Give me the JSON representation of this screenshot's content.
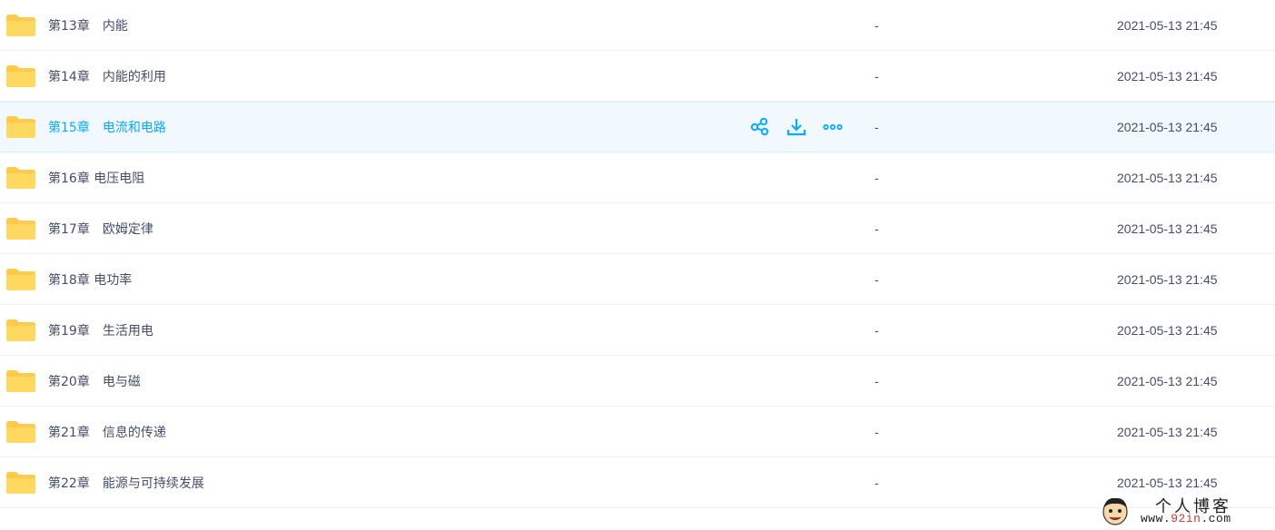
{
  "file_list": {
    "rows": [
      {
        "name": "第13章　内能",
        "size": "-",
        "mtime": "2021-05-13 21:45",
        "icon": "folder-icon"
      },
      {
        "name": "第14章　内能的利用",
        "size": "-",
        "mtime": "2021-05-13 21:45",
        "icon": "folder-icon"
      },
      {
        "name": "第15章　电流和电路",
        "size": "-",
        "mtime": "2021-05-13 21:45",
        "icon": "folder-icon",
        "hovered": true
      },
      {
        "name": "第16章 电压电阻",
        "size": "-",
        "mtime": "2021-05-13 21:45",
        "icon": "folder-icon"
      },
      {
        "name": "第17章　欧姆定律",
        "size": "-",
        "mtime": "2021-05-13 21:45",
        "icon": "folder-icon"
      },
      {
        "name": "第18章 电功率",
        "size": "-",
        "mtime": "2021-05-13 21:45",
        "icon": "folder-icon"
      },
      {
        "name": "第19章　生活用电",
        "size": "-",
        "mtime": "2021-05-13 21:45",
        "icon": "folder-icon"
      },
      {
        "name": "第20章　电与磁",
        "size": "-",
        "mtime": "2021-05-13 21:45",
        "icon": "folder-icon"
      },
      {
        "name": "第21章　信息的传递",
        "size": "-",
        "mtime": "2021-05-13 21:45",
        "icon": "folder-icon"
      },
      {
        "name": "第22章　能源与可持续发展",
        "size": "-",
        "mtime": "2021-05-13 21:45",
        "icon": "folder-icon"
      }
    ],
    "row_actions": [
      "share-icon",
      "download-icon",
      "more-icon"
    ]
  },
  "colors": {
    "text": "#424e67",
    "accent": "#09aaff",
    "hover_bg": "#f1f9fe",
    "folder": "#ffd04d",
    "divider": "#f0f0f0"
  },
  "watermark": {
    "title": "个人博客",
    "url_prefix": "www.",
    "url_accent": "92in",
    "url_suffix": ".com"
  }
}
